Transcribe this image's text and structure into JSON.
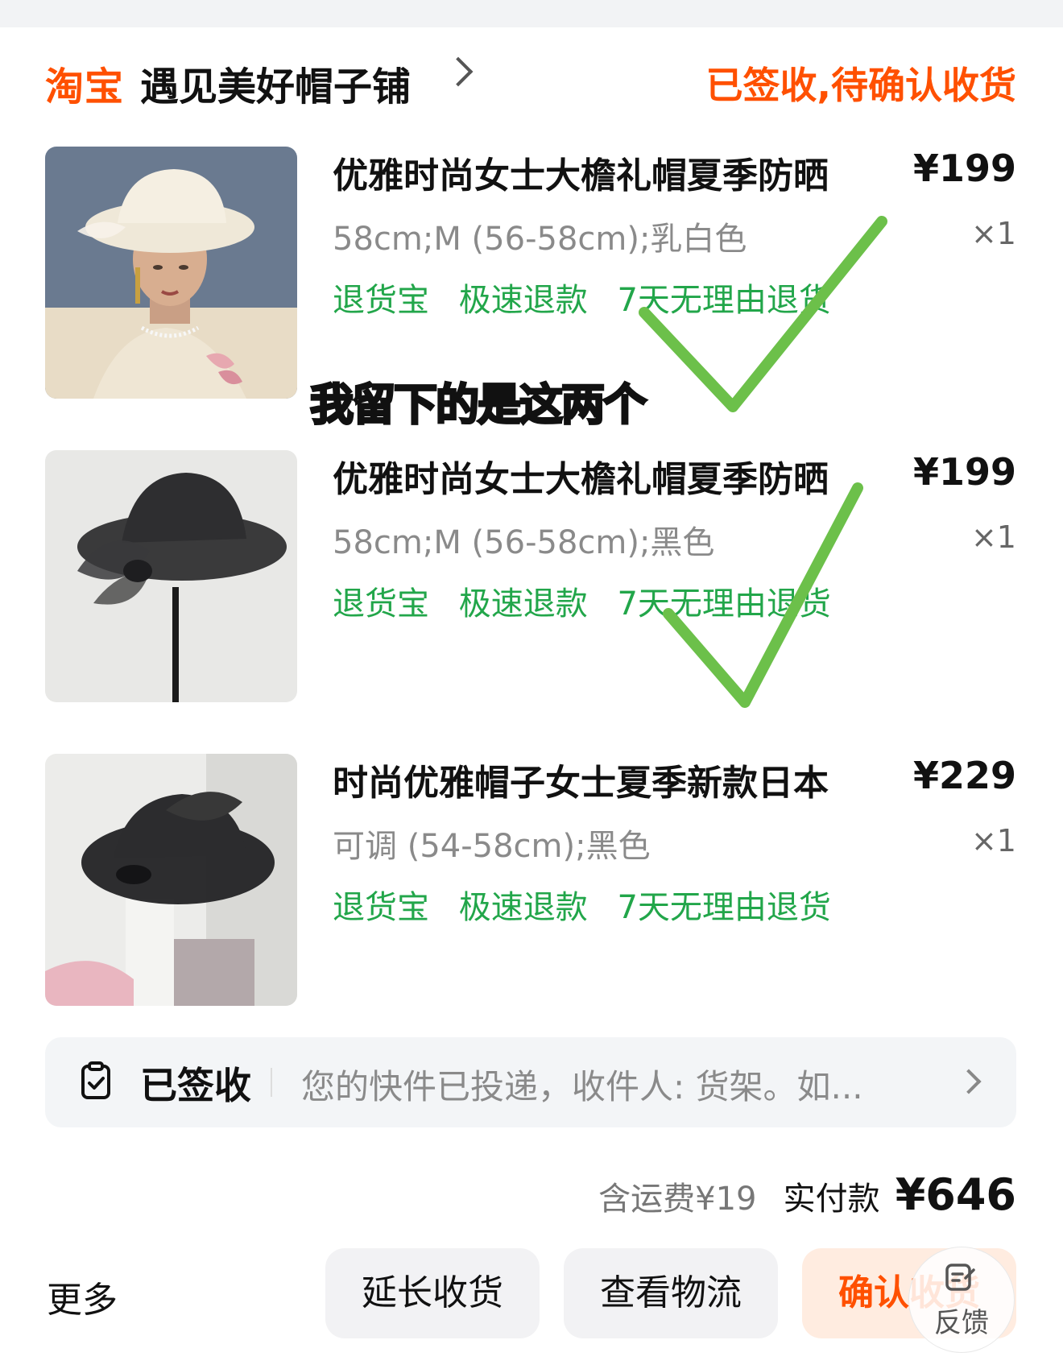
{
  "header": {
    "brand": "淘宝",
    "shop_name": "遇见美好帽子铺",
    "order_status": "已签收,待确认收货"
  },
  "items": [
    {
      "title": "优雅时尚女士大檐礼帽夏季防晒",
      "price": "¥199",
      "spec": "58cm;M (56-58cm);乳白色",
      "qty": "×1",
      "tags": [
        "退货宝",
        "极速退款",
        "7天无理由退货"
      ]
    },
    {
      "title": "优雅时尚女士大檐礼帽夏季防晒",
      "price": "¥199",
      "spec": "58cm;M (56-58cm);黑色",
      "qty": "×1",
      "tags": [
        "退货宝",
        "极速退款",
        "7天无理由退货"
      ]
    },
    {
      "title": "时尚优雅帽子女士夏季新款日本",
      "price": "¥229",
      "spec": "可调 (54-58cm);黑色",
      "qty": "×1",
      "tags": [
        "退货宝",
        "极速退款",
        "7天无理由退货"
      ]
    }
  ],
  "overlay_caption": "我留下的是这两个",
  "logistics": {
    "label": "已签收",
    "text": "您的快件已投递，收件人: 货架。如..."
  },
  "totals": {
    "shipping": "含运费¥19",
    "paid_label": "实付款",
    "paid_amount": "¥646"
  },
  "actions": {
    "more": "更多",
    "extend": "延长收货",
    "logistics": "查看物流",
    "confirm": "确认收货"
  },
  "feedback": {
    "label": "反馈"
  },
  "colors": {
    "brand": "#ff5000",
    "tag_green": "#22a64a",
    "check_green": "#6cc04a"
  },
  "icons": [
    "chevron-right-icon",
    "clipboard-check-icon",
    "feedback-edit-icon"
  ]
}
